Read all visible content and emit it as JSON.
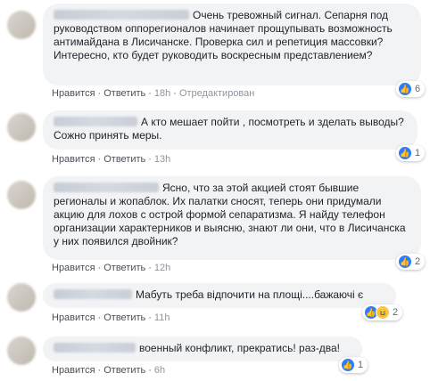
{
  "labels": {
    "like": "Нравится",
    "reply": "Ответить",
    "dot": "·"
  },
  "colors": {
    "bubble": "#f2f3f5",
    "link": "#4b4f56",
    "like_blue": "#2e7cf6"
  },
  "comments": [
    {
      "text": "Очень тревожный сигнал. Сепарня под руководством оппорегионалов начинает прощупывать возможность антимайдана в Лисичанске. Проверка сил и репетиция массовки?\nИнтересно, кто будет руководить воскресным представлением?",
      "time": "18h",
      "edited": "Отредактирован",
      "reaction_count": "6",
      "reaction_icons": [
        "like-icon"
      ]
    },
    {
      "text": "А кто мешает пойти , посмотреть и зделать выводы? Сожно принять меры.",
      "time": "13h",
      "reaction_count": "1",
      "reaction_icons": [
        "like-icon"
      ]
    },
    {
      "text": "Ясно, что за этой акцией стоят бывшие регионалы и жопаблок. Их палатки сносят, теперь они придумали акцию для лохов с острой формой сепаратизма. Я найду телефон организации характерников и выясню, знают ли они, что в Лисичанска у них появился двойник?",
      "time": "12h",
      "reaction_count": "2",
      "reaction_icons": [
        "like-icon"
      ]
    },
    {
      "text": "Мабуть треба відпочити на площі....бажаючі є",
      "time": "11h",
      "reaction_count": "2",
      "reaction_icons": [
        "like-icon",
        "haha-icon"
      ]
    },
    {
      "text": "военный конфликт, прекратись! раз-два!",
      "time": "6h",
      "reaction_count": "1",
      "reaction_icons": [
        "like-icon"
      ]
    }
  ]
}
